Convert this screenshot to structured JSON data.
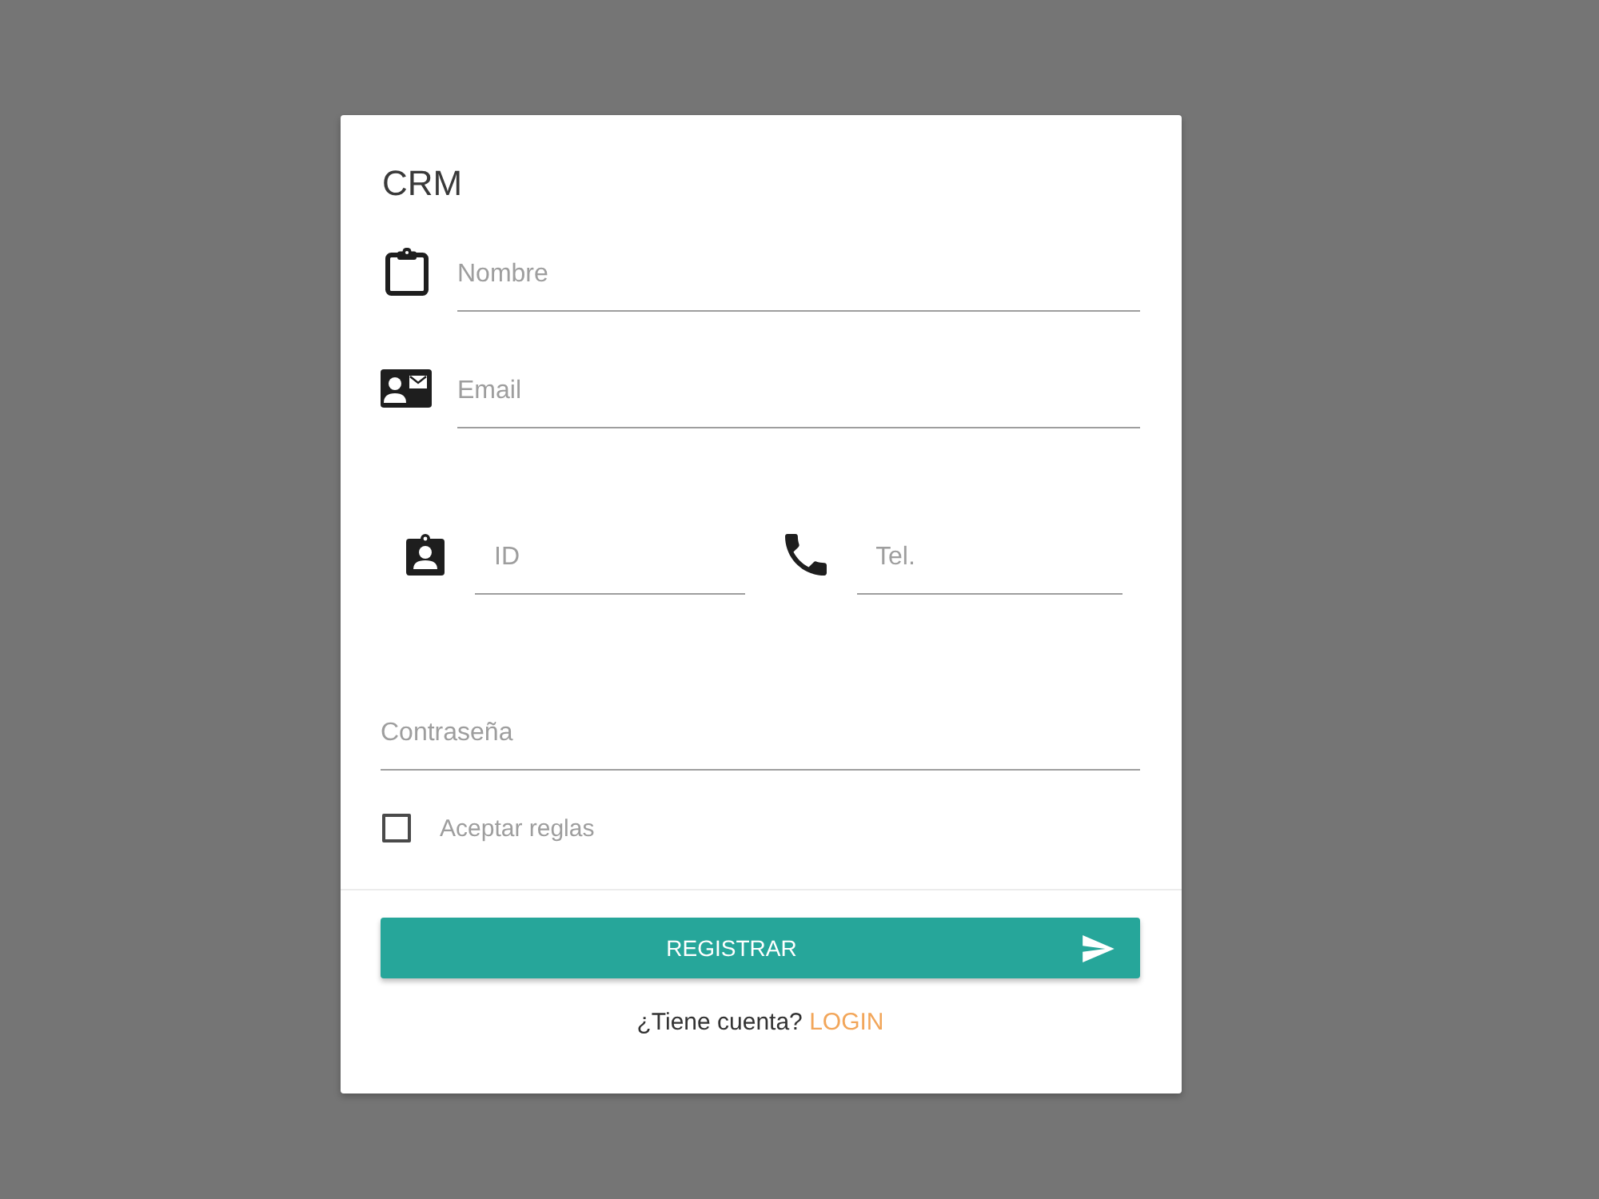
{
  "title": "CRM",
  "name_field": {
    "placeholder": "Nombre"
  },
  "email_field": {
    "placeholder": "Email"
  },
  "id_field": {
    "placeholder": "ID"
  },
  "phone_field": {
    "placeholder": "Tel."
  },
  "password_field": {
    "placeholder": "Contraseña"
  },
  "rules_checkbox": {
    "label": "Aceptar reglas",
    "checked": false
  },
  "submit_button": {
    "label": "REGISTRAR"
  },
  "footer": {
    "text": "¿Tiene cuenta?",
    "link": "LOGIN"
  }
}
